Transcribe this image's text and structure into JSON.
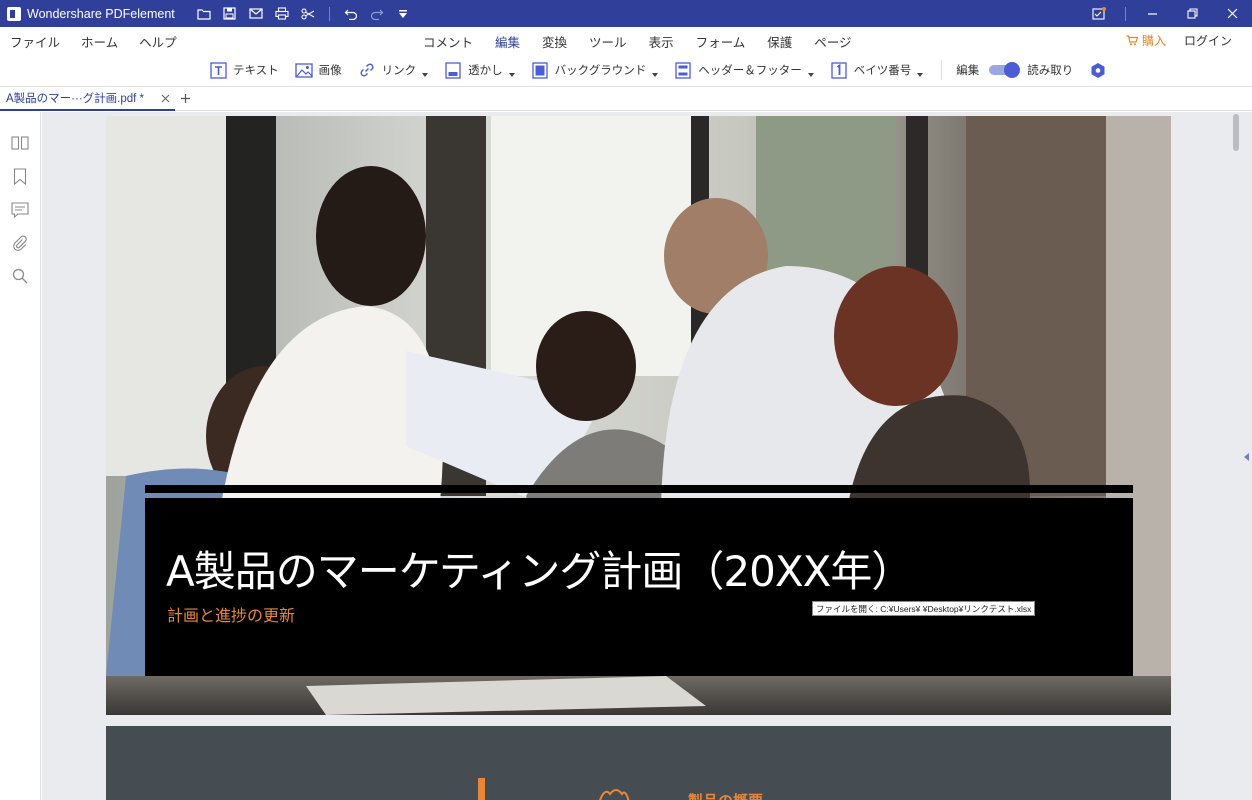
{
  "app": {
    "title": "Wondershare PDFelement"
  },
  "menu": {
    "left": [
      "ファイル",
      "ホーム",
      "ヘルプ"
    ],
    "tabs": [
      "コメント",
      "編集",
      "変換",
      "ツール",
      "表示",
      "フォーム",
      "保護",
      "ページ"
    ],
    "active_tab": "編集",
    "buy": "購入",
    "login": "ログイン"
  },
  "toolbar": {
    "tools": [
      {
        "label": "テキスト",
        "icon": "text-icon",
        "dropdown": false
      },
      {
        "label": "画像",
        "icon": "image-icon",
        "dropdown": false
      },
      {
        "label": "リンク",
        "icon": "link-icon",
        "dropdown": true
      },
      {
        "label": "透かし",
        "icon": "watermark-icon",
        "dropdown": true
      },
      {
        "label": "バックグラウンド",
        "icon": "background-icon",
        "dropdown": true
      },
      {
        "label": "ヘッダー＆フッター",
        "icon": "header-footer-icon",
        "dropdown": true
      },
      {
        "label": "ベイツ番号",
        "icon": "bates-number-icon",
        "dropdown": true
      }
    ],
    "mode_edit": "編集",
    "mode_read": "読み取り",
    "mode_toggle_on": true
  },
  "document": {
    "tab_label": "A製品のマー···グ計画.pdf *",
    "title": "A製品のマーケティング計画（20XX年）",
    "subtitle": "計画と進捗の更新",
    "tooltip": "ファイルを開く: C:¥Users¥        ¥Desktop¥リンクテスト.xlsx",
    "page2_heading": "製品の概要"
  },
  "colors": {
    "titlebar": "#2f3f9a",
    "accent": "#2f3f9a",
    "orange": "#e8873a",
    "canvas": "#e9ebee"
  }
}
